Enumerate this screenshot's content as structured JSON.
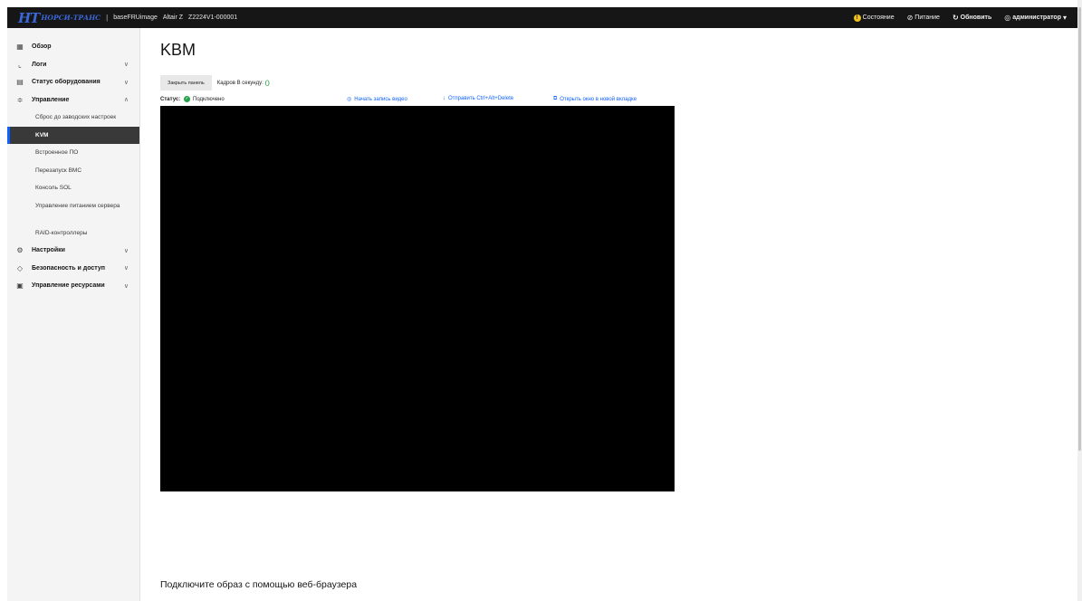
{
  "topbar": {
    "logo_mark": "НТ",
    "logo_text": "НОРСИ-ТРАНС",
    "separator": "|",
    "image_name": "baseFRUimage",
    "model": "Altair Z",
    "serial": "Z2224V1-000001",
    "status_label": "Состояние",
    "power_label": "Питание",
    "refresh_label": "Обновить",
    "user_label": "администратор"
  },
  "sidebar": {
    "items": [
      {
        "label": "Обзор",
        "icon": "dashboard-icon"
      },
      {
        "label": "Логи",
        "icon": "chart-icon"
      },
      {
        "label": "Статус оборудования",
        "icon": "document-icon"
      },
      {
        "label": "Управление",
        "icon": "settings-adjust-icon"
      }
    ],
    "sub_items": [
      "Сброс до заводских настроек",
      "KVM",
      "Встроенное ПО",
      "Перезапуск BMC",
      "Консоль SOL",
      "Управление питанием сервера",
      "RAID-контроллеры"
    ],
    "items_after": [
      {
        "label": "Настройки",
        "icon": "gear-icon"
      },
      {
        "label": "Безопасность и доступ",
        "icon": "shield-icon"
      },
      {
        "label": "Управление ресурсами",
        "icon": "resources-icon"
      }
    ]
  },
  "main": {
    "title": "KBM",
    "close_button": "Закрыть панель",
    "fps_label": "Кадров В секунду:",
    "fps_value": "0",
    "status_label": "Статус:",
    "status_value": "Подключено",
    "record_link": "Начать запись видео",
    "cad_link": "Отправить Ctrl+Alt+Delete",
    "new_tab_link": "Открыть окно в новой вкладке",
    "mount_title": "Подключите образ с помощью веб-браузера"
  },
  "colors": {
    "accent": "#0f62fe",
    "ok": "#24a148",
    "warning": "#f1c21b",
    "header_bg": "#161616"
  }
}
